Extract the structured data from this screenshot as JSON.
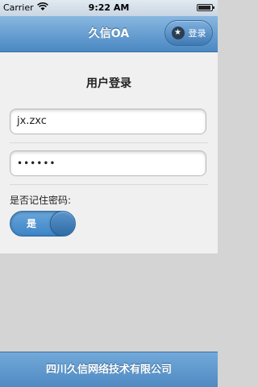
{
  "status_bar": {
    "carrier": "Carrier",
    "wifi_icon": "wifi-icon",
    "time": "9:22 AM",
    "battery_icon": "battery-icon"
  },
  "header": {
    "title": "久信OA",
    "login_label": "登录",
    "login_icon": "star-icon"
  },
  "form": {
    "title": "用户登录",
    "username_value": "jx.zxc",
    "password_value": "••••••",
    "remember_label": "是否记住密码:",
    "remember_toggle_label": "是"
  },
  "footer": {
    "text": "四川久信网络技术有限公司"
  },
  "colors": {
    "header_blue": "#4a88c3",
    "footer_blue": "#4f8ac2",
    "toggle_blue": "#3d84c6"
  }
}
